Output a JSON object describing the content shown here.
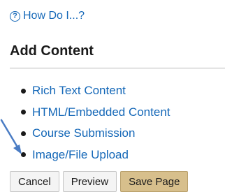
{
  "help": {
    "icon": "question-circle-icon",
    "label": "How Do I...?"
  },
  "section": {
    "title": "Add Content"
  },
  "content_types": [
    {
      "label": "Rich Text Content"
    },
    {
      "label": "HTML/Embedded Content"
    },
    {
      "label": "Course Submission"
    },
    {
      "label": "Image/File Upload"
    }
  ],
  "annotation": {
    "icon": "pointer-arrow-icon",
    "color": "#4a7cc4"
  },
  "actions": {
    "cancel_label": "Cancel",
    "preview_label": "Preview",
    "save_label": "Save Page"
  },
  "colors": {
    "link": "#1568b8",
    "save_button": "#d7bf8c"
  }
}
